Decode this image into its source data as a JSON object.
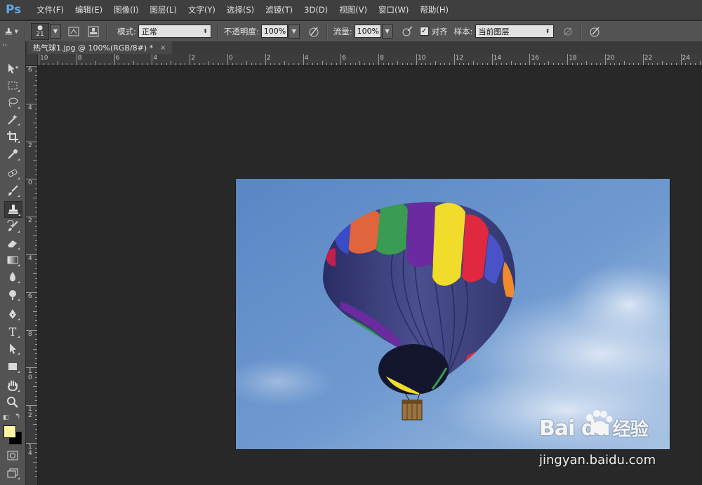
{
  "app": {
    "logo": "Ps"
  },
  "menu": [
    "文件(F)",
    "编辑(E)",
    "图像(I)",
    "图层(L)",
    "文字(Y)",
    "选择(S)",
    "滤镜(T)",
    "3D(D)",
    "视图(V)",
    "窗口(W)",
    "帮助(H)"
  ],
  "options": {
    "brush_size": "21",
    "mode_label": "模式:",
    "mode_value": "正常",
    "opacity_label": "不透明度:",
    "opacity_value": "100%",
    "flow_label": "流量:",
    "flow_value": "100%",
    "aligned_checked": true,
    "aligned_label": "对齐",
    "sample_label": "样本:",
    "sample_value": "当前图层"
  },
  "document": {
    "tab_title": "热气球1.jpg @ 100%(RGB/8#) *",
    "close": "×"
  },
  "rulers": {
    "horizontal": [
      "10",
      "8",
      "6",
      "4",
      "2",
      "0",
      "2",
      "4",
      "6",
      "8",
      "10",
      "12",
      "14",
      "16",
      "18",
      "20",
      "22",
      "24"
    ],
    "vertical": [
      "6",
      "4",
      "2",
      "0",
      "2",
      "4",
      "6",
      "8",
      "1\n0",
      "1\n2",
      "1\n4"
    ]
  },
  "tools": [
    {
      "name": "move-tool",
      "icon": "move-icon"
    },
    {
      "name": "marquee-tool",
      "icon": "marquee-icon"
    },
    {
      "name": "lasso-tool",
      "icon": "lasso-icon"
    },
    {
      "name": "magic-wand-tool",
      "icon": "magic-wand-icon"
    },
    {
      "name": "crop-tool",
      "icon": "crop-icon"
    },
    {
      "name": "eyedropper-tool",
      "icon": "eyedropper-icon"
    },
    {
      "name": "healing-brush-tool",
      "icon": "healing-icon"
    },
    {
      "name": "brush-tool",
      "icon": "brush-icon"
    },
    {
      "name": "clone-stamp-tool",
      "icon": "clone-stamp-icon",
      "active": true
    },
    {
      "name": "history-brush-tool",
      "icon": "history-brush-icon"
    },
    {
      "name": "eraser-tool",
      "icon": "eraser-icon"
    },
    {
      "name": "gradient-tool",
      "icon": "gradient-icon"
    },
    {
      "name": "blur-tool",
      "icon": "blur-icon"
    },
    {
      "name": "dodge-tool",
      "icon": "dodge-icon"
    },
    {
      "name": "pen-tool",
      "icon": "pen-icon"
    },
    {
      "name": "type-tool",
      "icon": "type-icon"
    },
    {
      "name": "path-selection-tool",
      "icon": "path-selection-icon"
    },
    {
      "name": "shape-tool",
      "icon": "rectangle-icon"
    },
    {
      "name": "hand-tool",
      "icon": "hand-icon"
    },
    {
      "name": "zoom-tool",
      "icon": "zoom-icon"
    }
  ],
  "colors": {
    "foreground": "#fdf5a0",
    "background": "#000000",
    "accent_ps": "#5ea8e6"
  },
  "watermark": {
    "brand": "Bai du",
    "brand_cn": "经验",
    "url": "jingyan.baidu.com"
  }
}
